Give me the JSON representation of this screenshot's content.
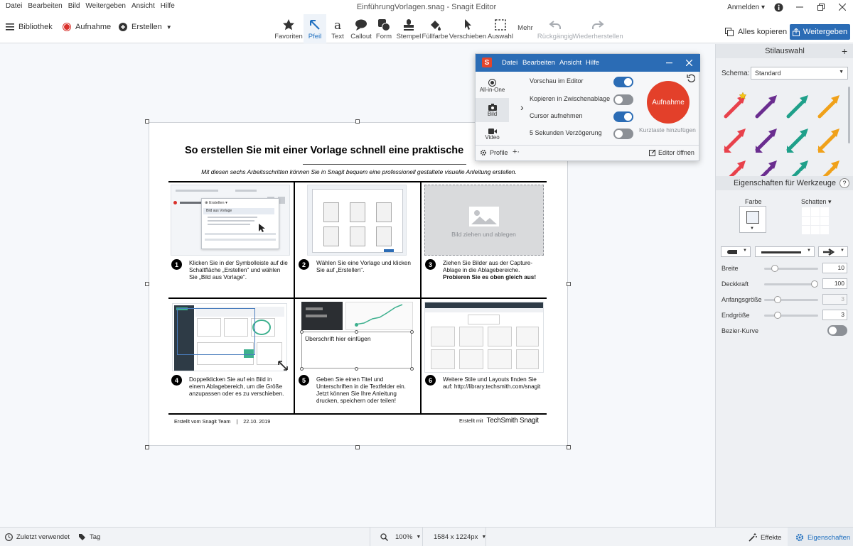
{
  "app": {
    "menu": [
      "Datei",
      "Bearbeiten",
      "Bild",
      "Weitergeben",
      "Ansicht",
      "Hilfe"
    ],
    "title": "EinführungVorlagen.snag - Snagit Editor",
    "user": "Anmelden",
    "accent": "#2b6cb5"
  },
  "toolbar": {
    "library": "Bibliothek",
    "capture": "Aufnahme",
    "create": "Erstellen",
    "tools": [
      "Favoriten",
      "Pfeil",
      "Text",
      "Callout",
      "Form",
      "Stempel",
      "Füllfarbe",
      "Verschieben",
      "Auswahl",
      "Mehr",
      "Rückgängig",
      "Wiederherstellen"
    ],
    "copy_all": "Alles kopieren",
    "share": "Weitergeben"
  },
  "document": {
    "title": "So erstellen Sie mit einer Vorlage schnell eine praktische",
    "subtitle": "Mit diesen sechs Arbeitsschritten können Sie in Snagit bequem eine professionell gestaltete visuelle Anleitung erstellen.",
    "steps": [
      {
        "n": "1",
        "text": "Klicken Sie in der Symbolleiste auf die Schaltfläche „Erstellen“ und wählen Sie „Bild aus Vorlage“."
      },
      {
        "n": "2",
        "text": "Wählen Sie eine Vorlage und klicken Sie auf „Erstellen“."
      },
      {
        "n": "3",
        "text": "Ziehen Sie Bilder aus der Capture-Ablage in die Ablagebereiche.",
        "bold": "Probieren Sie es oben gleich aus!"
      },
      {
        "n": "4",
        "text": "Doppelklicken Sie auf ein Bild in einem Ablagebereich, um die Größe anzupassen oder es zu verschieben."
      },
      {
        "n": "5",
        "text": "Geben Sie einen Titel und Unterschriften in die Textfelder ein. Jetzt können Sie Ihre Anleitung drucken, speichern oder teilen!"
      },
      {
        "n": "6",
        "text": "Weitere Stile und Layouts finden Sie auf: http://library.techsmith.com/snagit"
      }
    ],
    "drop_label": "Bild ziehen und ablegen",
    "heading_placeholder": "Überschrift hier einfügen",
    "thumb1_menu": "Erstellen",
    "thumb1_item": "Bild aus Vorlage",
    "footer_left": "Erstellt vom Snagit Team",
    "footer_sep": "|",
    "footer_date": "22.10. 2019",
    "footer_right": "Erstellt mit",
    "brand": "TechSmith Snagit"
  },
  "capture_panel": {
    "menu": [
      "Datei",
      "Bearbeiten",
      "Ansicht",
      "Hilfe"
    ],
    "modes": [
      "All-in-One",
      "Bild",
      "Video"
    ],
    "options": [
      {
        "label": "Vorschau im Editor",
        "on": true
      },
      {
        "label": "Kopieren in Zwischenablage",
        "on": false
      },
      {
        "label": "Cursor aufnehmen",
        "on": true
      },
      {
        "label": "5 Sekunden Verzögerung",
        "on": false
      }
    ],
    "capture_button": "Aufnahme",
    "hotkey": "Kurztaste hinzufügen",
    "profiles": "Profile",
    "open_editor": "Editor öffnen"
  },
  "styles_panel": {
    "title": "Stilauswahl",
    "scheme_label": "Schema:",
    "scheme_value": "Standard",
    "arrow_colors": [
      "#e8414b",
      "#6a2d8f",
      "#1fa08a",
      "#f0a11a"
    ]
  },
  "tool_props": {
    "title": "Eigenschaften für Werkzeuge",
    "color_label": "Farbe",
    "shadow_label": "Schatten",
    "props": [
      {
        "label": "Breite",
        "value": "10"
      },
      {
        "label": "Deckkraft",
        "value": "100"
      },
      {
        "label": "Anfangsgröße",
        "value": "3"
      },
      {
        "label": "Endgröße",
        "value": "3"
      }
    ],
    "bezier": "Bezier-Kurve"
  },
  "status": {
    "recent": "Zuletzt verwendet",
    "tag": "Tag",
    "zoom": "100%",
    "size": "1584 x 1224px",
    "effects": "Effekte",
    "properties": "Eigenschaften"
  }
}
